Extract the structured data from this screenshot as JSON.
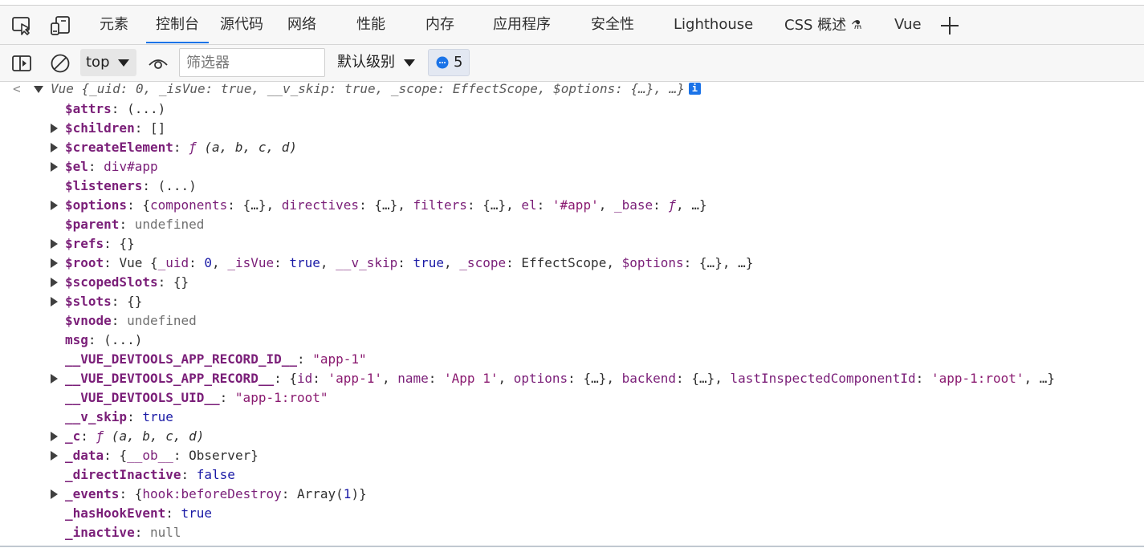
{
  "tabs": [
    {
      "id": "elements",
      "label": "元素"
    },
    {
      "id": "console",
      "label": "控制台",
      "active": true
    },
    {
      "id": "sources",
      "label": "源代码"
    },
    {
      "id": "network",
      "label": "网络"
    },
    {
      "id": "performance",
      "label": "性能"
    },
    {
      "id": "memory",
      "label": "内存"
    },
    {
      "id": "application",
      "label": "应用程序"
    },
    {
      "id": "security",
      "label": "安全性"
    },
    {
      "id": "lighthouse",
      "label": "Lighthouse"
    },
    {
      "id": "css-overview",
      "label": "CSS 概述"
    },
    {
      "id": "vue",
      "label": "Vue"
    }
  ],
  "toolbar": {
    "context": "top",
    "filter_placeholder": "筛选器",
    "level": "默认级别",
    "message_count": "5"
  },
  "console": {
    "summary": {
      "label": "Vue",
      "text": " {_uid: 0, _isVue: true, __v_skip: true, _scope: EffectScope, $options: {…}, …}"
    },
    "props": [
      {
        "key": "$attrs",
        "value": "(...)",
        "expandable": false
      },
      {
        "key": "$children",
        "value": "[]",
        "expandable": true
      },
      {
        "key": "$createElement",
        "value": "ƒ (a, b, c, d)",
        "expandable": true
      },
      {
        "key": "$el",
        "value": "div#app",
        "expandable": true
      },
      {
        "key": "$listeners",
        "value": "(...)",
        "expandable": false
      },
      {
        "key": "$options",
        "value": "{components: {…}, directives: {…}, filters: {…}, el: '#app', _base: ƒ, …}",
        "expandable": true
      },
      {
        "key": "$parent",
        "value": "undefined",
        "expandable": false
      },
      {
        "key": "$refs",
        "value": "{}",
        "expandable": true
      },
      {
        "key": "$root",
        "value": "Vue {_uid: 0, _isVue: true, __v_skip: true, _scope: EffectScope, $options: {…}, …}",
        "expandable": true
      },
      {
        "key": "$scopedSlots",
        "value": "{}",
        "expandable": true
      },
      {
        "key": "$slots",
        "value": "{}",
        "expandable": true
      },
      {
        "key": "$vnode",
        "value": "undefined",
        "expandable": false
      },
      {
        "key": "msg",
        "value": "(...)",
        "expandable": false
      },
      {
        "key": "__VUE_DEVTOOLS_APP_RECORD_ID__",
        "value": "\"app-1\"",
        "expandable": false
      },
      {
        "key": "__VUE_DEVTOOLS_APP_RECORD__",
        "value": "{id: 'app-1', name: 'App 1', options: {…}, backend: {…}, lastInspectedComponentId: 'app-1:root', …}",
        "expandable": true
      },
      {
        "key": "__VUE_DEVTOOLS_UID__",
        "value": "\"app-1:root\"",
        "expandable": false
      },
      {
        "key": "__v_skip",
        "value": "true",
        "expandable": false
      },
      {
        "key": "_c",
        "value": "ƒ (a, b, c, d)",
        "expandable": true
      },
      {
        "key": "_data",
        "value": "{__ob__: Observer}",
        "expandable": true
      },
      {
        "key": "_directInactive",
        "value": "false",
        "expandable": false
      },
      {
        "key": "_events",
        "value": "{hook:beforeDestroy: Array(1)}",
        "expandable": true
      },
      {
        "key": "_hasHookEvent",
        "value": "true",
        "expandable": false
      },
      {
        "key": "_inactive",
        "value": "null",
        "expandable": false
      }
    ]
  },
  "colors": {
    "accent": "#1a73e8",
    "key": "#7a1e78",
    "boolean": "#1a1aa6",
    "undefined": "#707070"
  }
}
